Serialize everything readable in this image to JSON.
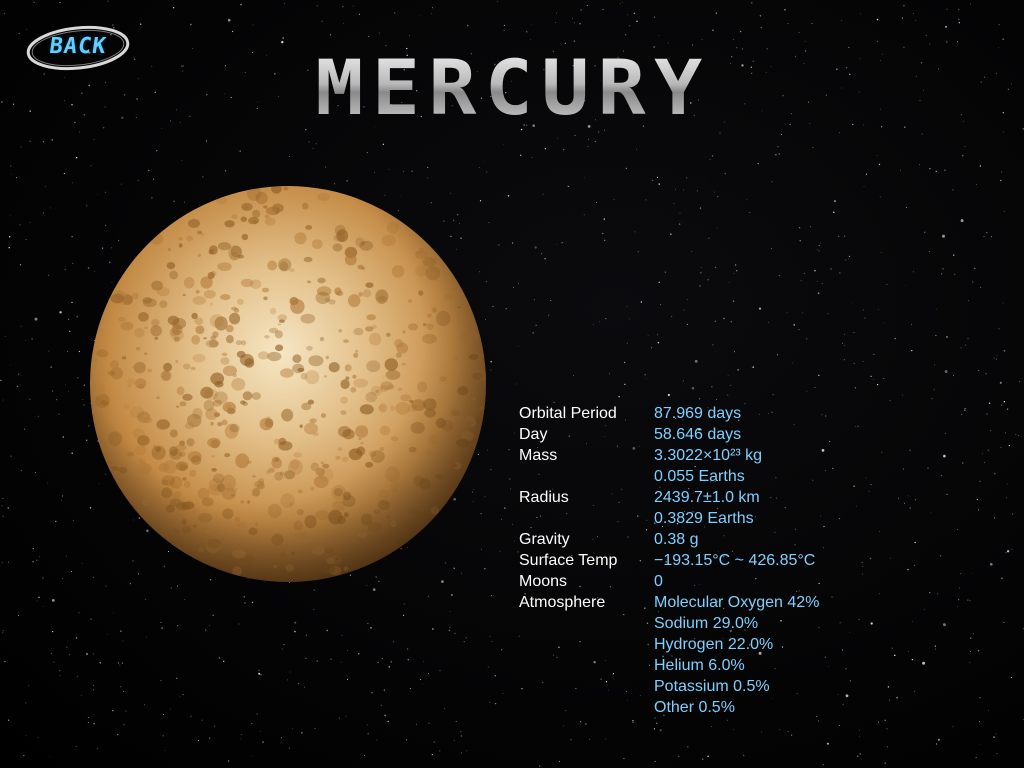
{
  "back_button": {
    "label": "BACK"
  },
  "title": "MERCURY",
  "colors": {
    "background": "#000000",
    "label": "#ffffff",
    "value": "#7fd0ff",
    "back_accent": "#5fd0ff",
    "planet_light": "#f3dcae",
    "planet_dark": "#8a5a1e"
  },
  "facts": [
    {
      "label": "Orbital Period",
      "values": [
        "87.969 days"
      ]
    },
    {
      "label": "Day",
      "values": [
        "58.646 days"
      ]
    },
    {
      "label": "Mass",
      "values": [
        "3.3022×10²³ kg",
        "0.055 Earths"
      ]
    },
    {
      "label": "Radius",
      "values": [
        "2439.7±1.0 km",
        "0.3829 Earths"
      ]
    },
    {
      "label": "Gravity",
      "values": [
        "0.38 g"
      ]
    },
    {
      "label": "Surface Temp",
      "values": [
        "−193.15°C ~ 426.85°C"
      ]
    },
    {
      "label": "Moons",
      "values": [
        "0"
      ]
    },
    {
      "label": "Atmosphere",
      "values": [
        "Molecular Oxygen 42%",
        "Sodium 29.0%",
        "Hydrogen 22.0%",
        "Helium 6.0%",
        "Potassium 0.5%",
        "Other 0.5%"
      ]
    }
  ]
}
